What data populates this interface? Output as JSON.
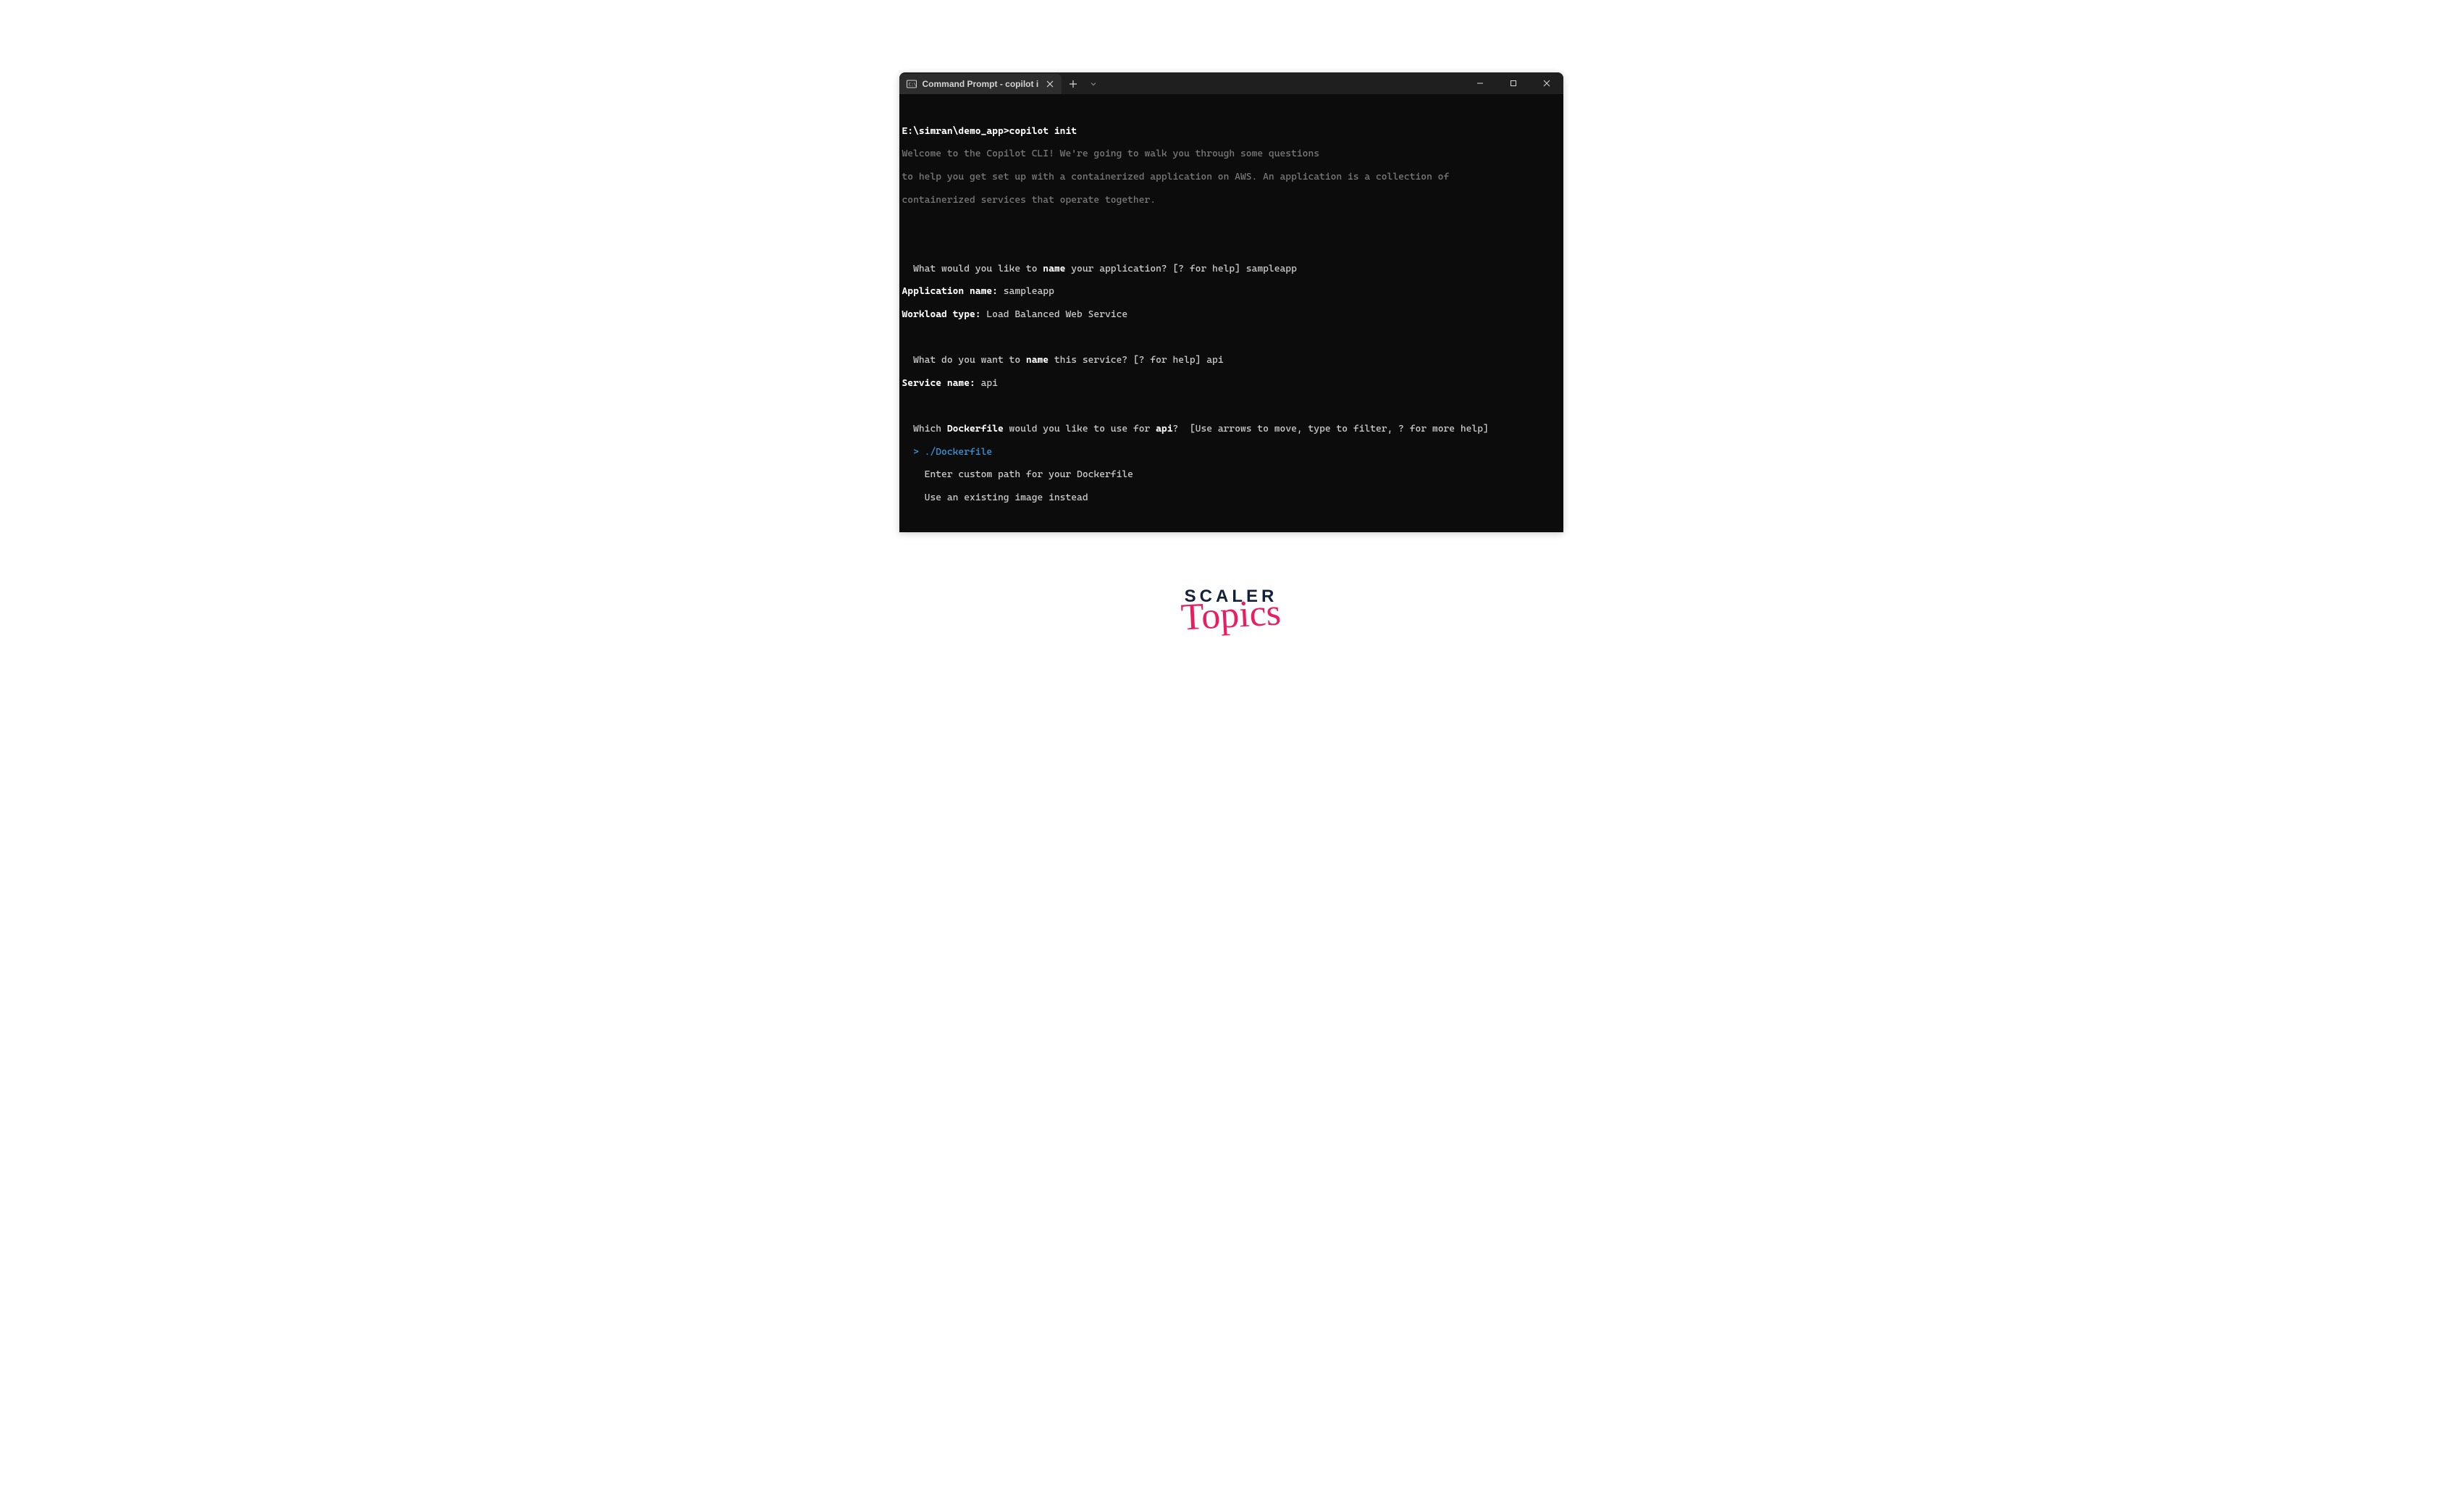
{
  "window": {
    "tab_title": "Command Prompt - copilot i",
    "controls": {
      "minimize": "−",
      "maximize": "☐",
      "close": "✕"
    }
  },
  "terminal": {
    "prompt_path": "E:\\simran\\demo_app>",
    "command": "copilot init",
    "welcome_line1": "Welcome to the Copilot CLI! We're going to walk you through some questions",
    "welcome_line2": "to help you get set up with a containerized application on AWS. An application is a collection of",
    "welcome_line3": "containerized services that operate together.",
    "q1_pre": "  What would you like to ",
    "q1_bold": "name",
    "q1_post": " your application? [? for help] sampleapp",
    "app_name_label": "Application name:",
    "app_name_value": " sampleapp",
    "workload_label": "Workload type:",
    "workload_value": " Load Balanced Web Service",
    "q2_pre": "  What do you want to ",
    "q2_bold": "name",
    "q2_post": " this service? [? for help] api",
    "service_name_label": "Service name:",
    "service_name_value": " api",
    "q3_pre": "  Which ",
    "q3_bold1": "Dockerfile",
    "q3_mid": " would you like to use for ",
    "q3_bold2": "api",
    "q3_post": "?  [Use arrows to move, type to filter, ? for more help]",
    "options": {
      "sel_marker": "  > ",
      "opt1": "./Dockerfile",
      "opt2_indent": "    ",
      "opt2": "Enter custom path for your Dockerfile",
      "opt3_indent": "    ",
      "opt3": "Use an existing image instead"
    }
  },
  "watermark": {
    "line1": "SCALER",
    "line2": "Topics"
  }
}
